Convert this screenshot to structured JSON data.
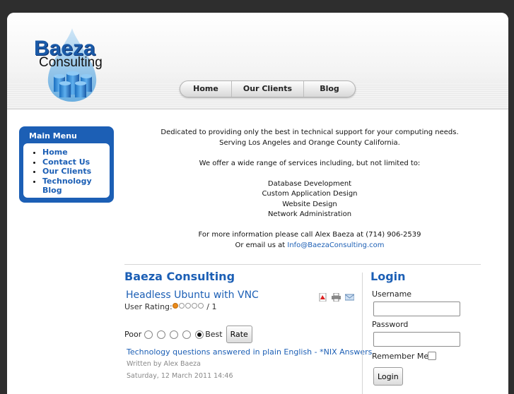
{
  "brand": {
    "line1": "Baeza",
    "line2": "Consulting"
  },
  "nav": [
    "Home",
    "Our Clients",
    "Blog"
  ],
  "sidebar": {
    "title": "Main Menu",
    "items": [
      "Home",
      "Contact Us",
      "Our Clients",
      "Technology Blog"
    ]
  },
  "intro": {
    "line1": "Dedicated to providing only the best in technical support for your computing needs.",
    "line2": "Serving Los Angeles and Orange County California.",
    "line3": "We offer a wide range of services including, but not limited to:",
    "services": [
      "Database Development",
      "Custom Application Design",
      "Website Design",
      "Network Administration"
    ],
    "contact": "For more information please call Alex Baeza at (714) 906-2539",
    "email_prefix": "Or email us at",
    "email": "Info@BaezaConsulting.com"
  },
  "blog": {
    "section_title": "Baeza Consulting",
    "post_title": "Headless Ubuntu with VNC",
    "rating_label": "User Rating:",
    "rating_value": 1,
    "rating_max": 5,
    "rating_count": "/ 1",
    "vote_low": "Poor",
    "vote_high": "Best",
    "rate_button": "Rate",
    "link_text": "Technology questions answered in plain English - *NIX Answers",
    "author": "Written by Alex Baeza",
    "date": "Saturday, 12 March 2011 14:46"
  },
  "login": {
    "title": "Login",
    "username_label": "Username",
    "username_value": "",
    "password_label": "Password",
    "password_value": "",
    "remember_label": "Remember Me",
    "button": "Login"
  },
  "colors": {
    "accent": "#1c5fb5",
    "star": "#e98a1b"
  },
  "icons": [
    "pdf-icon",
    "print-icon",
    "email-icon"
  ]
}
